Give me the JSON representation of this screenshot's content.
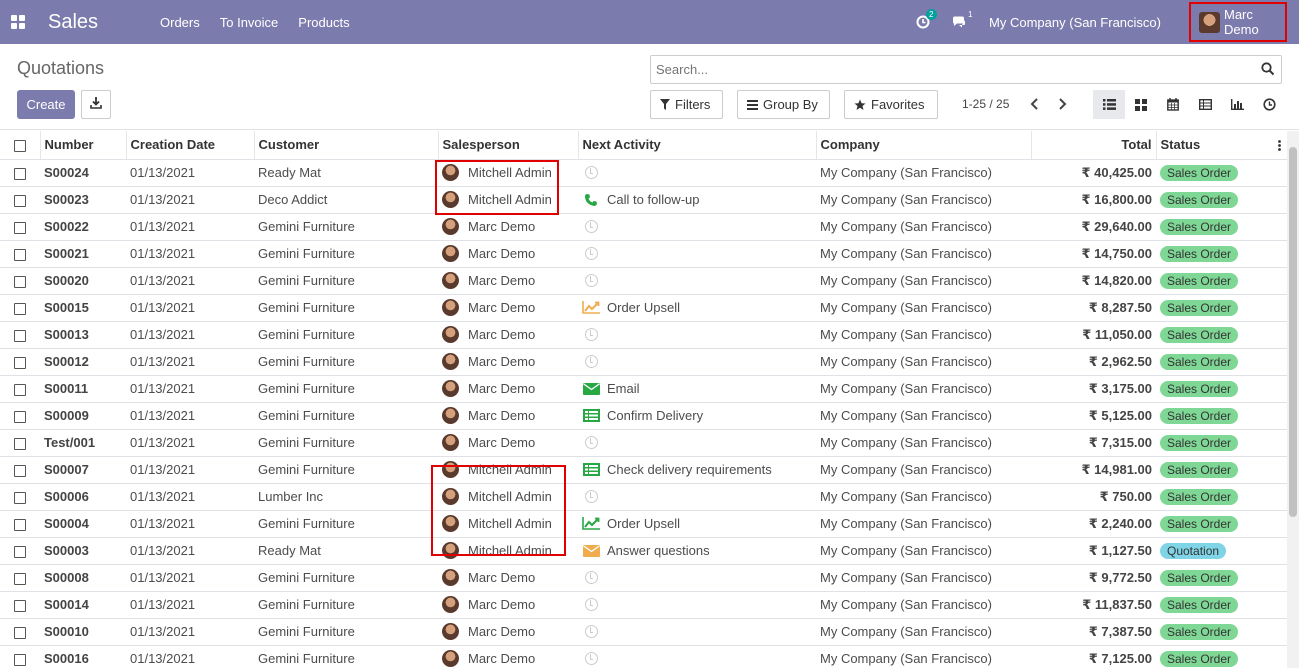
{
  "navbar": {
    "app_title": "Sales",
    "menu": [
      "Orders",
      "To Invoice",
      "Products"
    ],
    "activity_count": "2",
    "message_count": "1",
    "company": "My Company (San Francisco)",
    "user": "Marc Demo",
    "color": "#7c7bad"
  },
  "control": {
    "breadcrumb": "Quotations",
    "search_placeholder": "Search...",
    "create_label": "Create",
    "filters_label": "Filters",
    "groupby_label": "Group By",
    "favorites_label": "Favorites",
    "pager": "1-25 / 25"
  },
  "table": {
    "headers": {
      "number": "Number",
      "creation_date": "Creation Date",
      "customer": "Customer",
      "salesperson": "Salesperson",
      "next_activity": "Next Activity",
      "company": "Company",
      "total": "Total",
      "status": "Status"
    },
    "rows": [
      {
        "number": "S00024",
        "date": "01/13/2021",
        "customer": "Ready Mat",
        "salesperson": "Mitchell Admin",
        "activity": "",
        "activity_icon": "clock-icon",
        "company": "My Company (San Francisco)",
        "total": "₹ 40,425.00",
        "status": "Sales Order"
      },
      {
        "number": "S00023",
        "date": "01/13/2021",
        "customer": "Deco Addict",
        "salesperson": "Mitchell Admin",
        "activity": "Call to follow-up",
        "activity_icon": "phone-icon",
        "company": "My Company (San Francisco)",
        "total": "₹ 16,800.00",
        "status": "Sales Order"
      },
      {
        "number": "S00022",
        "date": "01/13/2021",
        "customer": "Gemini Furniture",
        "salesperson": "Marc Demo",
        "activity": "",
        "activity_icon": "clock-icon",
        "company": "My Company (San Francisco)",
        "total": "₹ 29,640.00",
        "status": "Sales Order"
      },
      {
        "number": "S00021",
        "date": "01/13/2021",
        "customer": "Gemini Furniture",
        "salesperson": "Marc Demo",
        "activity": "",
        "activity_icon": "clock-icon",
        "company": "My Company (San Francisco)",
        "total": "₹ 14,750.00",
        "status": "Sales Order"
      },
      {
        "number": "S00020",
        "date": "01/13/2021",
        "customer": "Gemini Furniture",
        "salesperson": "Marc Demo",
        "activity": "",
        "activity_icon": "clock-icon",
        "company": "My Company (San Francisco)",
        "total": "₹ 14,820.00",
        "status": "Sales Order"
      },
      {
        "number": "S00015",
        "date": "01/13/2021",
        "customer": "Gemini Furniture",
        "salesperson": "Marc Demo",
        "activity": "Order Upsell",
        "activity_icon": "chart-up-icon-orange",
        "company": "My Company (San Francisco)",
        "total": "₹ 8,287.50",
        "status": "Sales Order"
      },
      {
        "number": "S00013",
        "date": "01/13/2021",
        "customer": "Gemini Furniture",
        "salesperson": "Marc Demo",
        "activity": "",
        "activity_icon": "clock-icon",
        "company": "My Company (San Francisco)",
        "total": "₹ 11,050.00",
        "status": "Sales Order"
      },
      {
        "number": "S00012",
        "date": "01/13/2021",
        "customer": "Gemini Furniture",
        "salesperson": "Marc Demo",
        "activity": "",
        "activity_icon": "clock-icon",
        "company": "My Company (San Francisco)",
        "total": "₹ 2,962.50",
        "status": "Sales Order"
      },
      {
        "number": "S00011",
        "date": "01/13/2021",
        "customer": "Gemini Furniture",
        "salesperson": "Marc Demo",
        "activity": "Email",
        "activity_icon": "email-icon-green",
        "company": "My Company (San Francisco)",
        "total": "₹ 3,175.00",
        "status": "Sales Order"
      },
      {
        "number": "S00009",
        "date": "01/13/2021",
        "customer": "Gemini Furniture",
        "salesperson": "Marc Demo",
        "activity": "Confirm Delivery",
        "activity_icon": "tasks-icon",
        "company": "My Company (San Francisco)",
        "total": "₹ 5,125.00",
        "status": "Sales Order"
      },
      {
        "number": "Test/001",
        "date": "01/13/2021",
        "customer": "Gemini Furniture",
        "salesperson": "Marc Demo",
        "activity": "",
        "activity_icon": "clock-icon",
        "company": "My Company (San Francisco)",
        "total": "₹ 7,315.00",
        "status": "Sales Order"
      },
      {
        "number": "S00007",
        "date": "01/13/2021",
        "customer": "Gemini Furniture",
        "salesperson": "Mitchell Admin",
        "activity": "Check delivery requirements",
        "activity_icon": "tasks-icon",
        "company": "My Company (San Francisco)",
        "total": "₹ 14,981.00",
        "status": "Sales Order"
      },
      {
        "number": "S00006",
        "date": "01/13/2021",
        "customer": "Lumber Inc",
        "salesperson": "Mitchell Admin",
        "activity": "",
        "activity_icon": "clock-icon",
        "company": "My Company (San Francisco)",
        "total": "₹ 750.00",
        "status": "Sales Order"
      },
      {
        "number": "S00004",
        "date": "01/13/2021",
        "customer": "Gemini Furniture",
        "salesperson": "Mitchell Admin",
        "activity": "Order Upsell",
        "activity_icon": "chart-up-icon-green",
        "company": "My Company (San Francisco)",
        "total": "₹ 2,240.00",
        "status": "Sales Order"
      },
      {
        "number": "S00003",
        "date": "01/13/2021",
        "customer": "Ready Mat",
        "salesperson": "Mitchell Admin",
        "activity": "Answer questions",
        "activity_icon": "email-icon-orange",
        "company": "My Company (San Francisco)",
        "total": "₹ 1,127.50",
        "status": "Quotation"
      },
      {
        "number": "S00008",
        "date": "01/13/2021",
        "customer": "Gemini Furniture",
        "salesperson": "Marc Demo",
        "activity": "",
        "activity_icon": "clock-icon",
        "company": "My Company (San Francisco)",
        "total": "₹ 9,772.50",
        "status": "Sales Order"
      },
      {
        "number": "S00014",
        "date": "01/13/2021",
        "customer": "Gemini Furniture",
        "salesperson": "Marc Demo",
        "activity": "",
        "activity_icon": "clock-icon",
        "company": "My Company (San Francisco)",
        "total": "₹ 11,837.50",
        "status": "Sales Order"
      },
      {
        "number": "S00010",
        "date": "01/13/2021",
        "customer": "Gemini Furniture",
        "salesperson": "Marc Demo",
        "activity": "",
        "activity_icon": "clock-icon",
        "company": "My Company (San Francisco)",
        "total": "₹ 7,387.50",
        "status": "Sales Order"
      },
      {
        "number": "S00016",
        "date": "01/13/2021",
        "customer": "Gemini Furniture",
        "salesperson": "Marc Demo",
        "activity": "",
        "activity_icon": "clock-icon",
        "company": "My Company (San Francisco)",
        "total": "₹ 7,125.00",
        "status": "Sales Order"
      }
    ]
  },
  "colors": {
    "sales_order_badge": "#7fd795",
    "quotation_badge": "#7fd4e6",
    "highlight": "#e00000"
  }
}
